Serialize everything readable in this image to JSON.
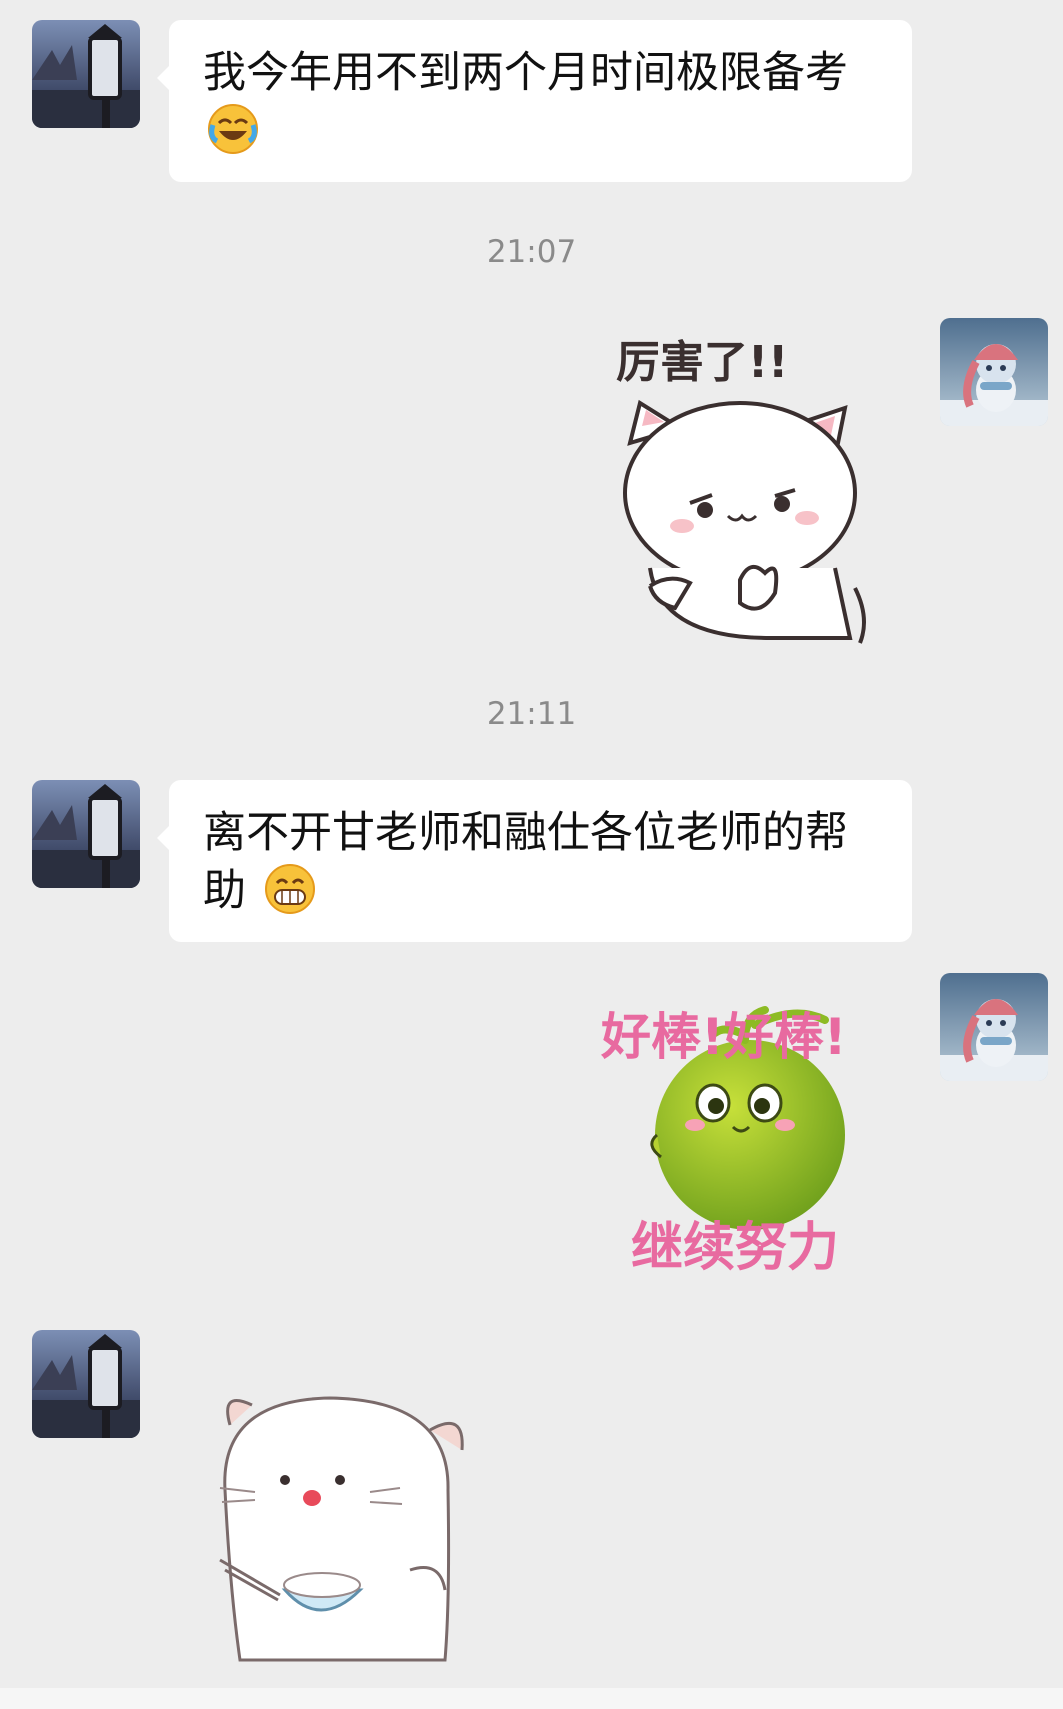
{
  "messages": [
    {
      "text": "我今年用不到两个月时间极限备考",
      "emoji": "face-with-tears-of-joy-icon"
    },
    {
      "text": "离不开甘老师和融仕各位老师的帮助",
      "emoji": "grinning-face-icon"
    }
  ],
  "timestamps": [
    "21:07",
    "21:11"
  ],
  "stickers": {
    "cat": {
      "caption": "厉害了!!"
    },
    "melon": {
      "caption_top": "好棒!好棒!",
      "caption_bottom": "继续努力"
    },
    "hamster": {}
  },
  "colors": {
    "background": "#ededed",
    "bubble": "#ffffff",
    "timestamp": "#8a8a8a",
    "sticker_pink": "#e86aa0",
    "melon_green": "#8dbb24"
  }
}
